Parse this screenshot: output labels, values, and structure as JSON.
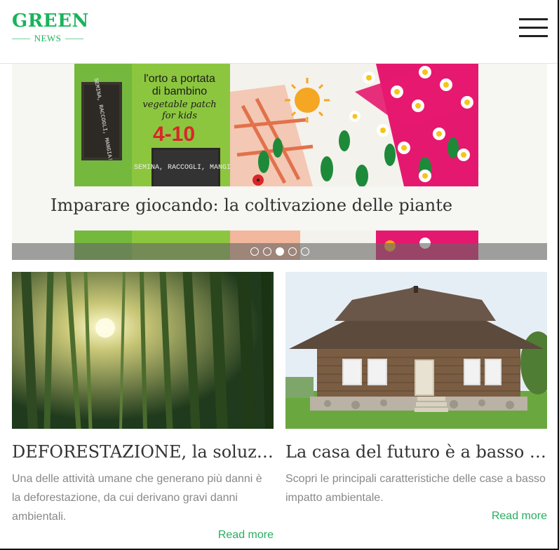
{
  "header": {
    "logo_main": "GREEN",
    "logo_sub": "NEWS"
  },
  "slider": {
    "title": "Imparare giocando: la coltivazione delle piante",
    "slide_count": 5,
    "active_slide_index": 2,
    "image_text": {
      "line1": "l'orto a portata",
      "line2": "di bambino",
      "line3": "vegetable patch",
      "line4": "for kids",
      "age": "4-10",
      "board1": "SEMINA, RACCOGLI, MANGIA!",
      "board2": "SEMINA, RACCOGLI, MANGIA!"
    }
  },
  "articles": [
    {
      "title": "DEFORESTAZIONE, la soluzion...",
      "excerpt": "Una delle attività umane che generano più danni è la deforestazione, da cui derivano gravi danni ambientali.",
      "read_more": "Read more"
    },
    {
      "title": "La casa del futuro è a basso imp...",
      "excerpt": "Scopri le principali caratteristiche delle case a basso impatto ambientale.",
      "read_more": "Read more"
    }
  ],
  "colors": {
    "brand_green": "#18b35a",
    "link_green": "#27ae60",
    "title_text": "#333333",
    "excerpt_text": "#888888"
  }
}
